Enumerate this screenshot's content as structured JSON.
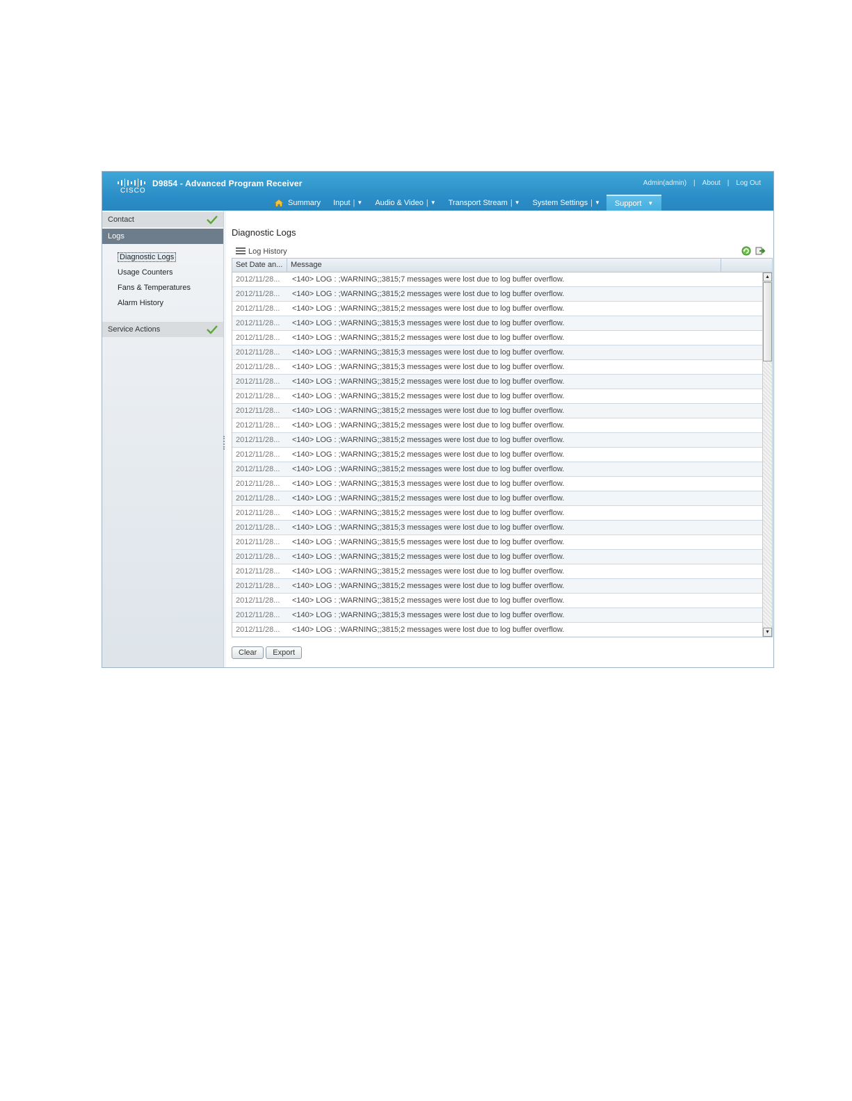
{
  "app": {
    "product": "D9854 - Advanced Program Receiver",
    "logo_text": "CISCO",
    "user": "Admin(admin)",
    "about": "About",
    "logout": "Log Out"
  },
  "nav": [
    {
      "label": "Summary",
      "icon": "home-icon"
    },
    {
      "label": "Input",
      "has_menu": true
    },
    {
      "label": "Audio & Video",
      "has_menu": true
    },
    {
      "label": "Transport Stream",
      "has_menu": true
    },
    {
      "label": "System Settings",
      "has_menu": true
    },
    {
      "label": "Support",
      "has_menu": true,
      "active": true
    }
  ],
  "sidebar": {
    "sections": [
      {
        "label": "Contact",
        "status_icon": "check-icon"
      },
      {
        "label": "Logs",
        "active": true
      },
      {
        "label": "Service Actions",
        "status_icon": "check-icon"
      }
    ],
    "log_items": [
      "Diagnostic Logs",
      "Usage Counters",
      "Fans & Temperatures",
      "Alarm History"
    ],
    "selected": "Diagnostic Logs"
  },
  "main": {
    "title": "Diagnostic Logs",
    "panel_label": "Log History",
    "columns": [
      "Set Date an...",
      "Message"
    ],
    "rows": [
      {
        "date": "2012/11/28...",
        "message": "<140> LOG : ;WARNING;;3815;7 messages were lost due to log buffer overflow."
      },
      {
        "date": "2012/11/28...",
        "message": "<140> LOG : ;WARNING;;3815;2 messages were lost due to log buffer overflow."
      },
      {
        "date": "2012/11/28...",
        "message": "<140> LOG : ;WARNING;;3815;2 messages were lost due to log buffer overflow."
      },
      {
        "date": "2012/11/28...",
        "message": "<140> LOG : ;WARNING;;3815;3 messages were lost due to log buffer overflow."
      },
      {
        "date": "2012/11/28...",
        "message": "<140> LOG : ;WARNING;;3815;2 messages were lost due to log buffer overflow."
      },
      {
        "date": "2012/11/28...",
        "message": "<140> LOG : ;WARNING;;3815;3 messages were lost due to log buffer overflow."
      },
      {
        "date": "2012/11/28...",
        "message": "<140> LOG : ;WARNING;;3815;3 messages were lost due to log buffer overflow."
      },
      {
        "date": "2012/11/28...",
        "message": "<140> LOG : ;WARNING;;3815;2 messages were lost due to log buffer overflow."
      },
      {
        "date": "2012/11/28...",
        "message": "<140> LOG : ;WARNING;;3815;2 messages were lost due to log buffer overflow."
      },
      {
        "date": "2012/11/28...",
        "message": "<140> LOG : ;WARNING;;3815;2 messages were lost due to log buffer overflow."
      },
      {
        "date": "2012/11/28...",
        "message": "<140> LOG : ;WARNING;;3815;2 messages were lost due to log buffer overflow."
      },
      {
        "date": "2012/11/28...",
        "message": "<140> LOG : ;WARNING;;3815;2 messages were lost due to log buffer overflow."
      },
      {
        "date": "2012/11/28...",
        "message": "<140> LOG : ;WARNING;;3815;2 messages were lost due to log buffer overflow."
      },
      {
        "date": "2012/11/28...",
        "message": "<140> LOG : ;WARNING;;3815;2 messages were lost due to log buffer overflow."
      },
      {
        "date": "2012/11/28...",
        "message": "<140> LOG : ;WARNING;;3815;3 messages were lost due to log buffer overflow."
      },
      {
        "date": "2012/11/28...",
        "message": "<140> LOG : ;WARNING;;3815;2 messages were lost due to log buffer overflow."
      },
      {
        "date": "2012/11/28...",
        "message": "<140> LOG : ;WARNING;;3815;2 messages were lost due to log buffer overflow."
      },
      {
        "date": "2012/11/28...",
        "message": "<140> LOG : ;WARNING;;3815;3 messages were lost due to log buffer overflow."
      },
      {
        "date": "2012/11/28...",
        "message": "<140> LOG : ;WARNING;;3815;5 messages were lost due to log buffer overflow."
      },
      {
        "date": "2012/11/28...",
        "message": "<140> LOG : ;WARNING;;3815;2 messages were lost due to log buffer overflow."
      },
      {
        "date": "2012/11/28...",
        "message": "<140> LOG : ;WARNING;;3815;2 messages were lost due to log buffer overflow."
      },
      {
        "date": "2012/11/28...",
        "message": "<140> LOG : ;WARNING;;3815;2 messages were lost due to log buffer overflow."
      },
      {
        "date": "2012/11/28...",
        "message": "<140> LOG : ;WARNING;;3815;2 messages were lost due to log buffer overflow."
      },
      {
        "date": "2012/11/28...",
        "message": "<140> LOG : ;WARNING;;3815;3 messages were lost due to log buffer overflow."
      },
      {
        "date": "2012/11/28...",
        "message": "<140> LOG : ;WARNING;;3815;2 messages were lost due to log buffer overflow."
      }
    ],
    "buttons": {
      "clear": "Clear",
      "export": "Export"
    }
  },
  "colors": {
    "header": "#2a8cc6",
    "active_section": "#6d7d8b",
    "check": "#5aa832"
  }
}
